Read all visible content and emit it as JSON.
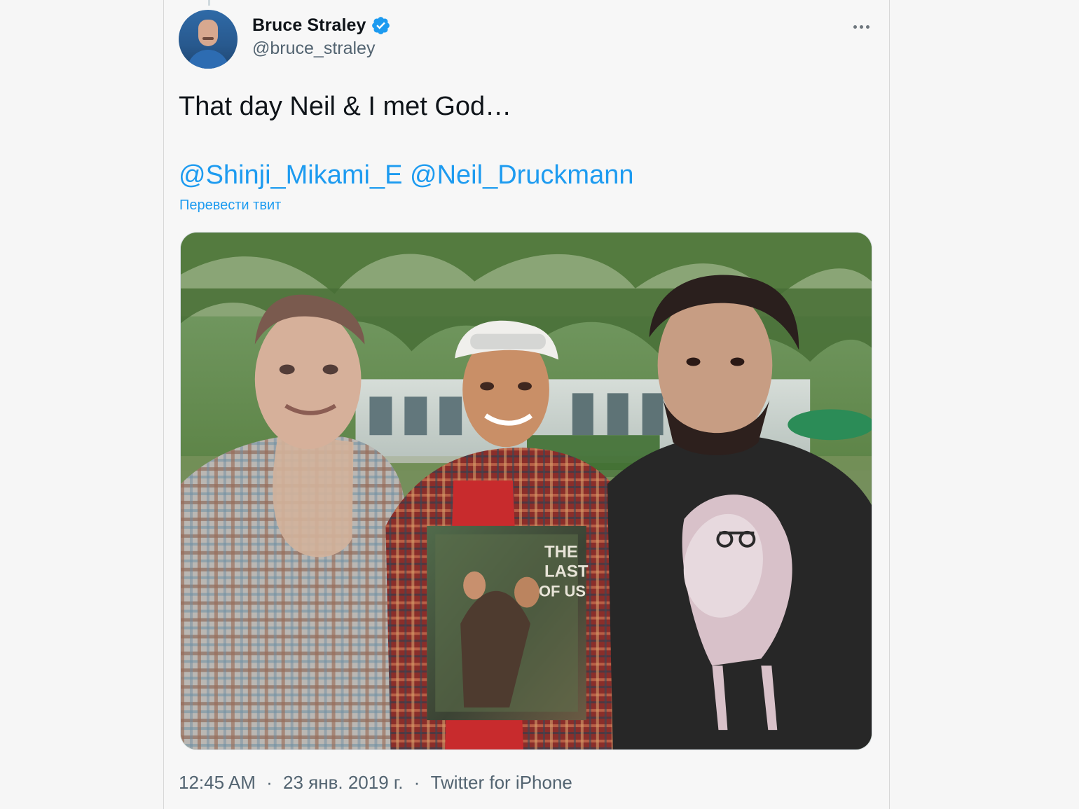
{
  "tweet": {
    "display_name": "Bruce Straley",
    "handle": "@bruce_straley",
    "text": "That day Neil & I met God…",
    "mentions": [
      "@Shinji_Mikami_E",
      "@Neil_Druckmann"
    ],
    "translate_label": "Перевести твит",
    "time": "12:45 AM",
    "date": "23 янв. 2019 г.",
    "separator": "·",
    "source": "Twitter for iPhone"
  },
  "photo": {
    "book_title_lines": [
      "THE",
      "LAST",
      "OF US"
    ]
  },
  "colors": {
    "link": "#1d9bf0",
    "primary_text": "#0f1419",
    "secondary_text": "#536471",
    "verified": "#1d9bf0"
  },
  "icons": {
    "verified": "verified-icon",
    "more": "more-icon"
  }
}
